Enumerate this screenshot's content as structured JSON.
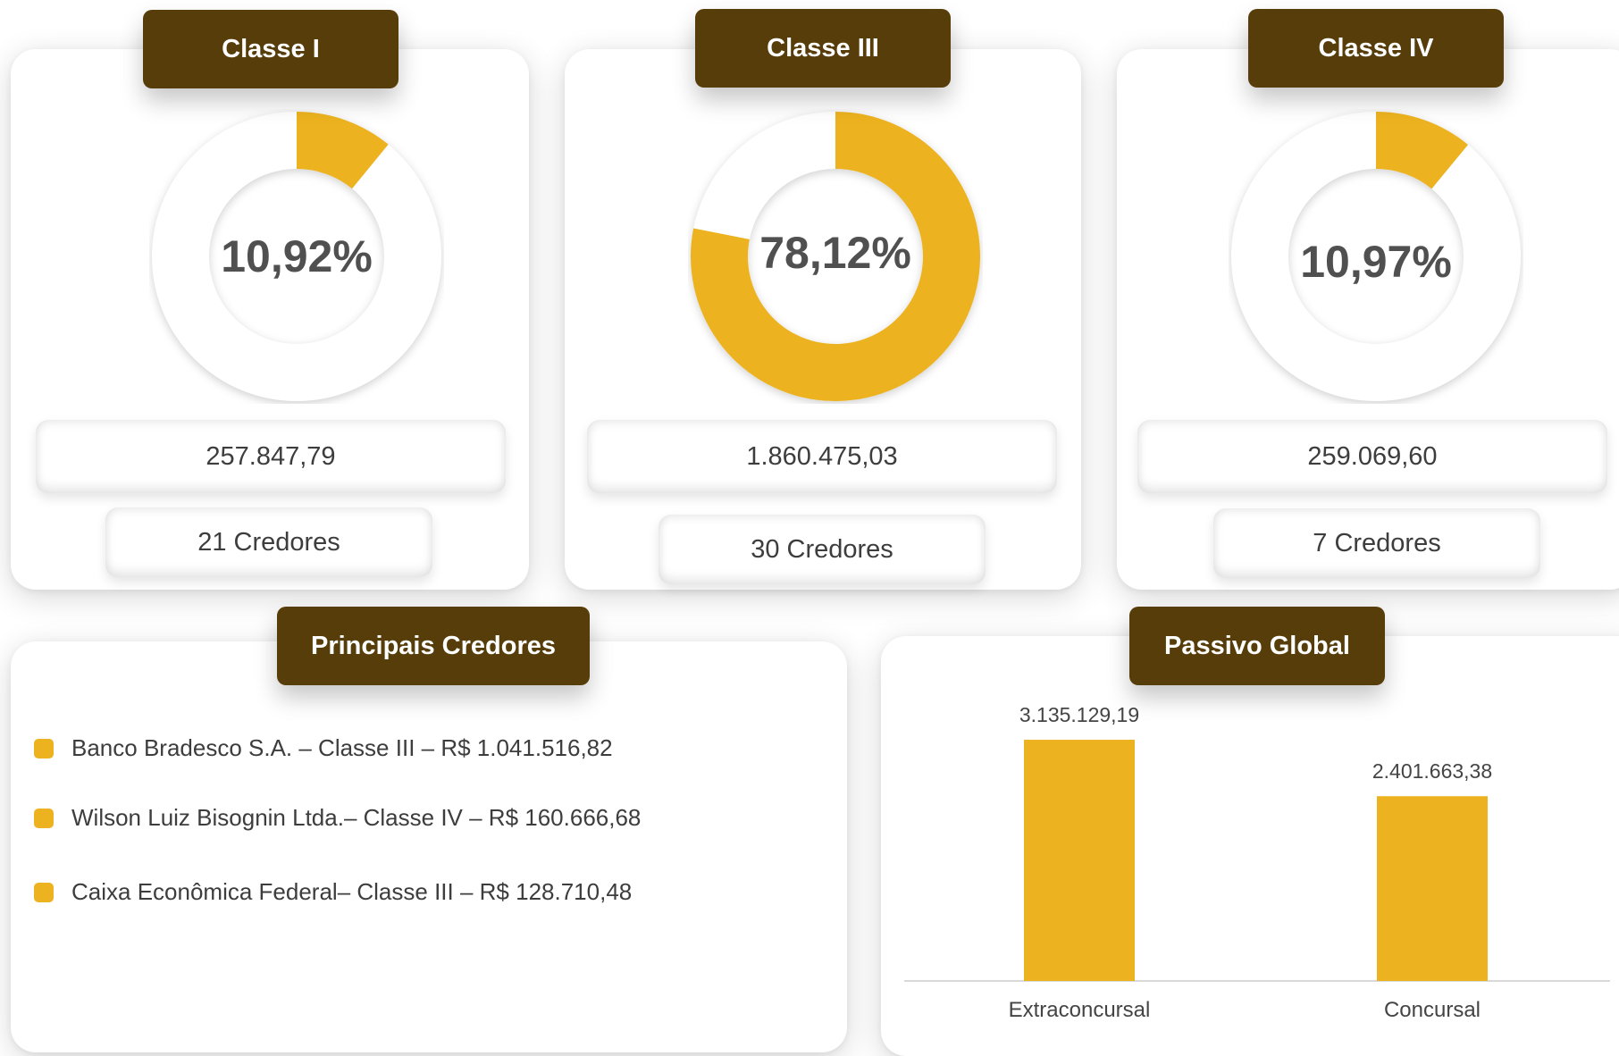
{
  "colors": {
    "header_bg": "#573d0a",
    "accent": "#ecb21f",
    "ring_bg": "#ffffff"
  },
  "classes": [
    {
      "title": "Classe I",
      "percent": "10,92%",
      "value": "257.847,79",
      "creditors": "21 Credores"
    },
    {
      "title": "Classe III",
      "percent": "78,12%",
      "value": "1.860.475,03",
      "creditors": "30 Credores"
    },
    {
      "title": "Classe IV",
      "percent": "10,97%",
      "value": "259.069,60",
      "creditors": "7 Credores"
    }
  ],
  "principais": {
    "title": "Principais Credores",
    "items": [
      "Banco Bradesco S.A. – Classe III – R$ 1.041.516,82",
      "Wilson Luiz Bisognin Ltda.– Classe IV – R$ 160.666,68",
      "Caixa Econômica Federal– Classe III – R$ 128.710,48"
    ]
  },
  "passivo": {
    "title": "Passivo Global"
  },
  "chart_data": [
    {
      "type": "pie",
      "title": "Classe I",
      "values": [
        10.92,
        89.08
      ]
    },
    {
      "type": "pie",
      "title": "Classe III",
      "values": [
        78.12,
        21.88
      ]
    },
    {
      "type": "pie",
      "title": "Classe IV",
      "values": [
        10.97,
        89.03
      ]
    },
    {
      "type": "bar",
      "title": "Passivo Global",
      "categories": [
        "Extraconcursal",
        "Concursal"
      ],
      "values": [
        3135129.19,
        2401663.38
      ],
      "value_labels": [
        "3.135.129,19",
        "2.401.663,38"
      ],
      "ylim": [
        0,
        3600000
      ],
      "grid": false
    }
  ]
}
